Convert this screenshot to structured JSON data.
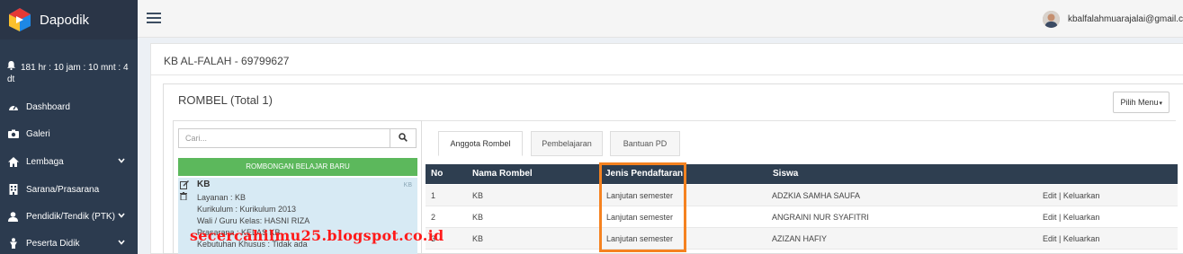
{
  "app": {
    "name": "Dapodik"
  },
  "sidebar": {
    "timer": "181 hr : 10 jam : 10 mnt : 4 dt",
    "items": [
      {
        "label": "Dashboard",
        "icon": "dashboard-icon"
      },
      {
        "label": "Galeri",
        "icon": "camera-icon"
      },
      {
        "label": "Lembaga",
        "icon": "home-icon",
        "has_children": true
      },
      {
        "label": "Sarana/Prasarana",
        "icon": "building-icon"
      },
      {
        "label": "Pendidik/Tendik (PTK)",
        "icon": "user-icon",
        "has_children": true
      },
      {
        "label": "Peserta Didik",
        "icon": "student-icon",
        "has_children": true
      }
    ]
  },
  "topbar": {
    "user_email": "kbalfalahmuarajalai@gmail.c"
  },
  "page": {
    "title": "KB AL-FALAH - 69799627"
  },
  "rombel": {
    "title": "ROMBEL (Total 1)",
    "menu_button": "Pilih Menu",
    "search_placeholder": "Cari...",
    "add_button": "ROMBONGAN BELAJAR BARU",
    "card": {
      "name": "KB",
      "tag": "KB",
      "layanan": "Layanan : KB",
      "kurikulum": "Kurikulum : Kurikulum 2013",
      "wali": "Wali / Guru Kelas: HASNI RIZA",
      "prasarana": "Prasarana : KELAS KB",
      "kebutuhan": "Kebutuhan Khusus : Tidak ada"
    }
  },
  "tabs": [
    "Anggota Rombel",
    "Pembelajaran",
    "Bantuan PD"
  ],
  "table": {
    "headers": [
      "No",
      "Nama Rombel",
      "Jenis Pendaftaran",
      "Siswa"
    ],
    "rows": [
      {
        "no": "1",
        "rombel": "KB",
        "jenis": "Lanjutan semester",
        "siswa": "ADZKIA SAMHA SAUFA",
        "action_edit": "Edit",
        "action_sep": "|",
        "action_keluar": "Keluarkan"
      },
      {
        "no": "2",
        "rombel": "KB",
        "jenis": "Lanjutan semester",
        "siswa": "ANGRAINI NUR SYAFITRI",
        "action_edit": "Edit",
        "action_sep": "|",
        "action_keluar": "Keluarkan"
      },
      {
        "no": "3",
        "rombel": "KB",
        "jenis": "Lanjutan semester",
        "siswa": "AZIZAN HAFIY",
        "action_edit": "Edit",
        "action_sep": "|",
        "action_keluar": "Keluarkan"
      }
    ]
  },
  "watermark": "secercahilmu25.blogspot.co.id",
  "colors": {
    "sidebar": "#2c3b4f",
    "table_header": "#2e3e50",
    "highlight": "#f58220",
    "green": "#5cb85c",
    "card": "#d7eaf4",
    "watermark": "#ff1a1a"
  }
}
